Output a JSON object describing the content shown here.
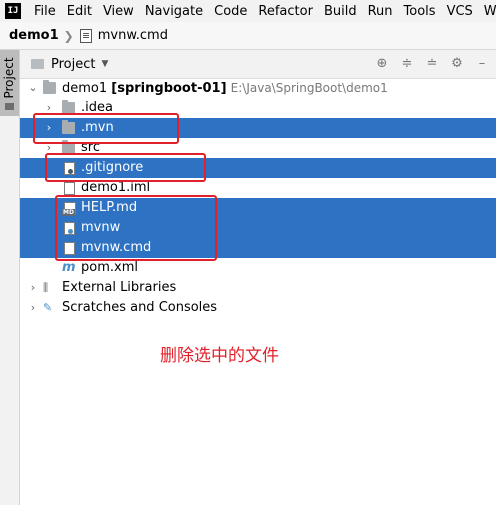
{
  "menubar": {
    "logo": "IJ",
    "items": [
      "File",
      "Edit",
      "View",
      "Navigate",
      "Code",
      "Refactor",
      "Build",
      "Run",
      "Tools",
      "VCS",
      "Windo"
    ]
  },
  "navbar": {
    "root": "demo1",
    "file": "mvnw.cmd"
  },
  "side_tab": {
    "label": "Project"
  },
  "toolbar": {
    "title": "Project"
  },
  "tree": {
    "root": {
      "name": "demo1",
      "module": "[springboot-01]",
      "path": "E:\\Java\\SpringBoot\\demo1"
    },
    "idea": ".idea",
    "mvn": ".mvn",
    "src": "src",
    "gitignore": ".gitignore",
    "demo1_iml": "demo1.iml",
    "help_md": "HELP.md",
    "mvnw": "mvnw",
    "mvnw_cmd": "mvnw.cmd",
    "pom": "pom.xml",
    "external_libraries": "External Libraries",
    "scratches": "Scratches and Consoles"
  },
  "annotation": {
    "text": "删除选中的文件"
  },
  "colors": {
    "selection": "#2d72c3",
    "annotation": "#e0202a"
  }
}
